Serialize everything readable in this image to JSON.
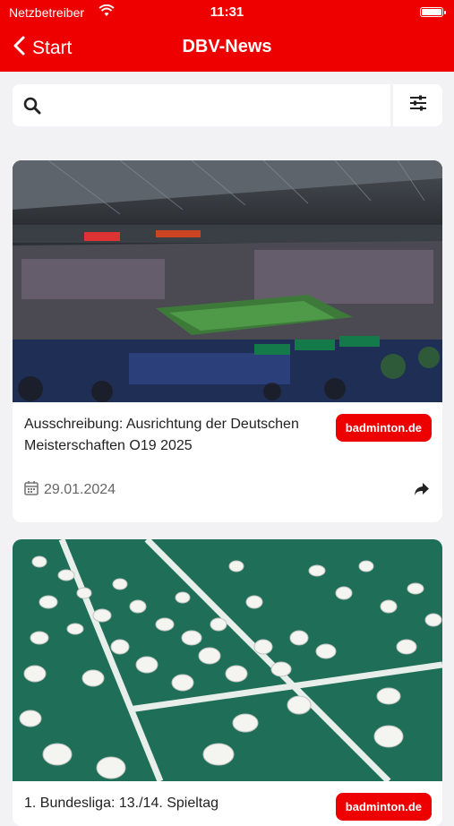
{
  "status": {
    "carrier": "Netzbetreiber",
    "time": "11:31"
  },
  "nav": {
    "back_label": "Start",
    "title": "DBV-News"
  },
  "search": {
    "placeholder": ""
  },
  "articles": [
    {
      "title": "Ausschreibung: Ausrichtung der Deutschen Meisterschaften O19 2025",
      "source": "badminton.de",
      "date": "29.01.2024"
    },
    {
      "title": "1. Bundesliga: 13./14. Spieltag",
      "source": "badminton.de"
    }
  ],
  "colors": {
    "brand_red": "#ee0000",
    "background": "#f2f2f4"
  }
}
